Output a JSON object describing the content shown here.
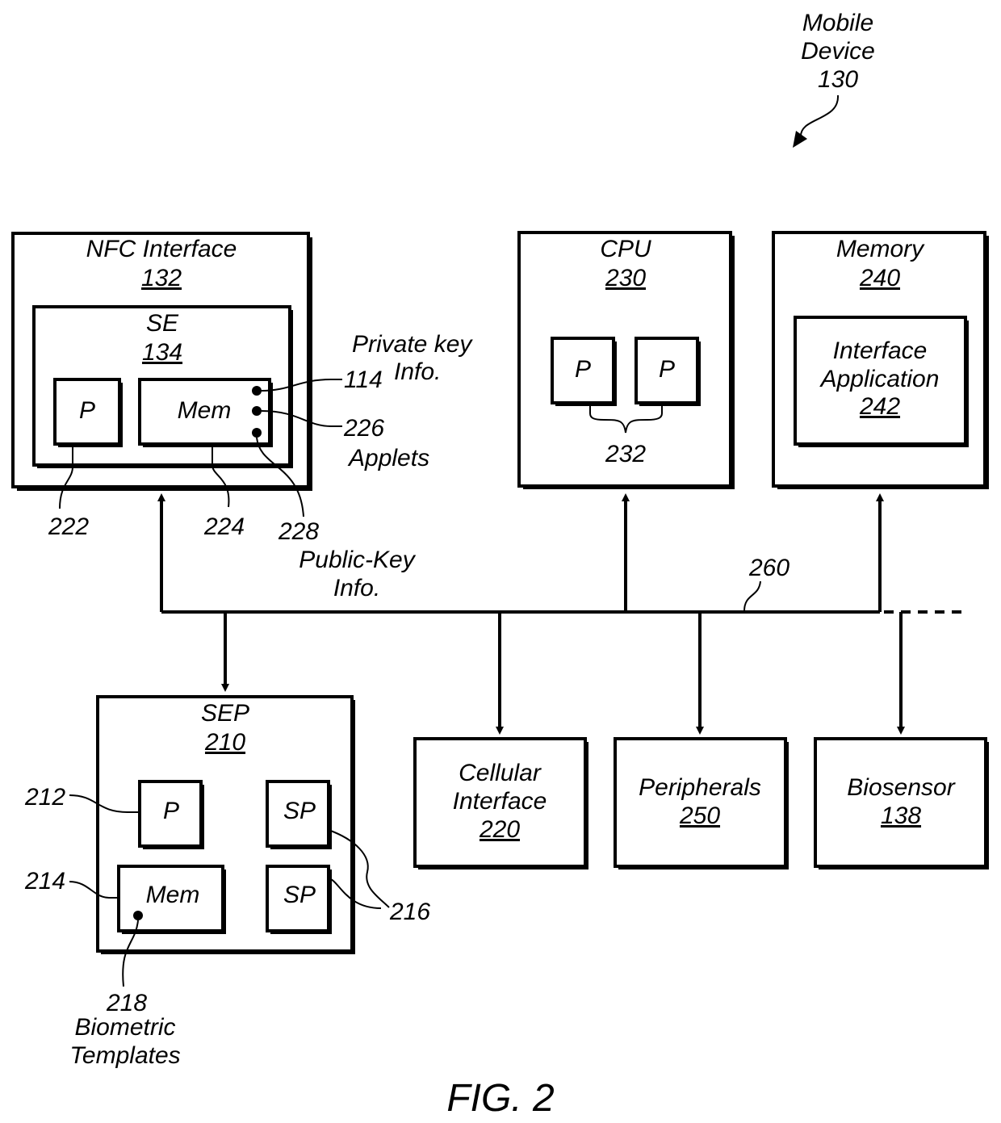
{
  "figure": {
    "caption": "FIG. 2",
    "device": {
      "name_line1": "Mobile",
      "name_line2": "Device",
      "ref": "130"
    }
  },
  "blocks": {
    "nfc": {
      "title": "NFC Interface",
      "ref": "132"
    },
    "se": {
      "title": "SE",
      "ref": "134"
    },
    "se_p": {
      "title": "P"
    },
    "se_mem": {
      "title": "Mem"
    },
    "cpu": {
      "title": "CPU",
      "ref": "230"
    },
    "cpu_p1": {
      "title": "P"
    },
    "cpu_p2": {
      "title": "P"
    },
    "memory": {
      "title": "Memory",
      "ref": "240"
    },
    "iface_app": {
      "title_line1": "Interface",
      "title_line2": "Application",
      "ref": "242"
    },
    "sep": {
      "title": "SEP",
      "ref": "210"
    },
    "sep_p": {
      "title": "P"
    },
    "sep_sp1": {
      "title": "SP"
    },
    "sep_sp2": {
      "title": "SP"
    },
    "sep_mem": {
      "title": "Mem"
    },
    "cellular": {
      "title_line1": "Cellular",
      "title_line2": "Interface",
      "ref": "220"
    },
    "peripherals": {
      "title": "Peripherals",
      "ref": "250"
    },
    "biosensor": {
      "title": "Biosensor",
      "ref": "138"
    }
  },
  "callouts": {
    "private_key": {
      "line1": "Private key",
      "line2": "Info.",
      "ref": "114"
    },
    "applets": {
      "ref": "226",
      "label": "Applets"
    },
    "public_key": {
      "ref": "228",
      "line1": "Public-Key",
      "line2": "Info."
    },
    "se_processor": {
      "ref": "222"
    },
    "se_memory": {
      "ref": "224"
    },
    "cpu_processors": {
      "ref": "232"
    },
    "bus": {
      "ref": "260"
    },
    "sep_processor": {
      "ref": "212"
    },
    "sep_memory": {
      "ref": "214"
    },
    "secure_processors": {
      "ref": "216"
    },
    "biometric": {
      "ref": "218",
      "line1": "Biometric",
      "line2": "Templates"
    }
  }
}
